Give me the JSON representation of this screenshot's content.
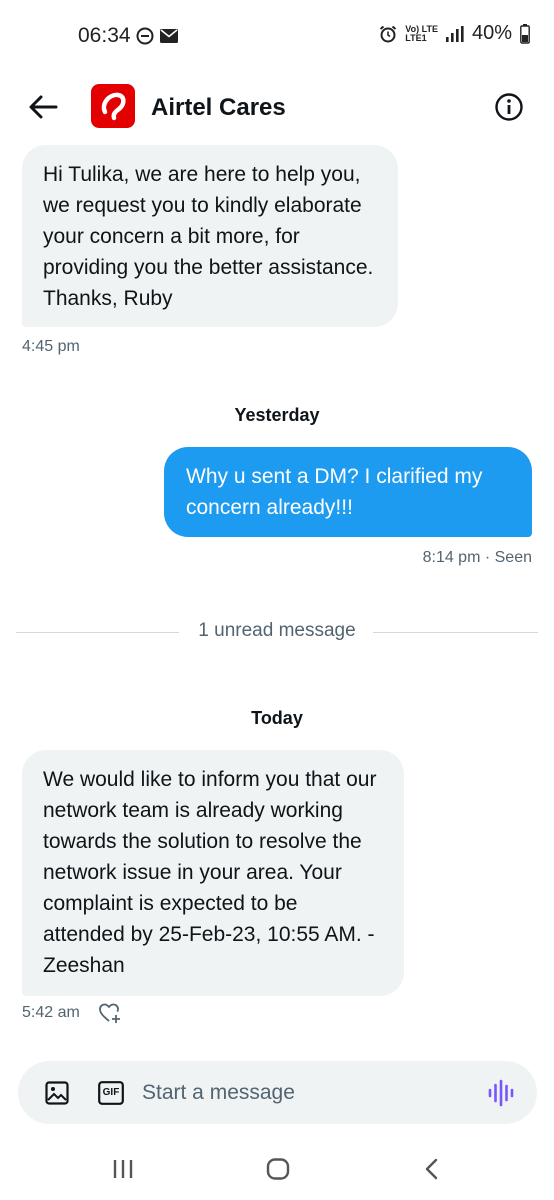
{
  "status_bar": {
    "time": "06:34",
    "network_top": "Vo) LTE",
    "network_bottom": "LTE1",
    "battery": "40%"
  },
  "header": {
    "title": "Airtel Cares",
    "accent_color": "#e40000"
  },
  "messages": [
    {
      "direction": "incoming",
      "text": "Hi Tulika, we are here to help you, we request you to kindly elaborate your concern a bit more, for providing you the better assistance. Thanks, Ruby",
      "time": "4:45 pm"
    },
    {
      "direction": "outgoing",
      "text": "Why u sent a DM? I clarified my concern already!!!",
      "time": "8:14 pm · Seen"
    },
    {
      "direction": "incoming",
      "text": "We would like to inform you that our network team is already working towards the solution to resolve the network issue in your area. Your complaint is expected to be attended by 25-Feb-23, 10:55 AM. - Zeeshan",
      "time": "5:42 am"
    }
  ],
  "day_labels": {
    "yesterday": "Yesterday",
    "today": "Today"
  },
  "unread_divider": "1 unread message",
  "composer": {
    "placeholder": "Start a message",
    "gif_label": "GIF"
  },
  "colors": {
    "outgoing_bubble": "#1d9bf0",
    "incoming_bubble": "#eff3f4",
    "voice_icon": "#7856ff"
  },
  "icons": [
    "back-arrow-icon",
    "info-icon",
    "image-icon",
    "gif-icon",
    "voice-wave-icon",
    "heart-plus-icon"
  ]
}
